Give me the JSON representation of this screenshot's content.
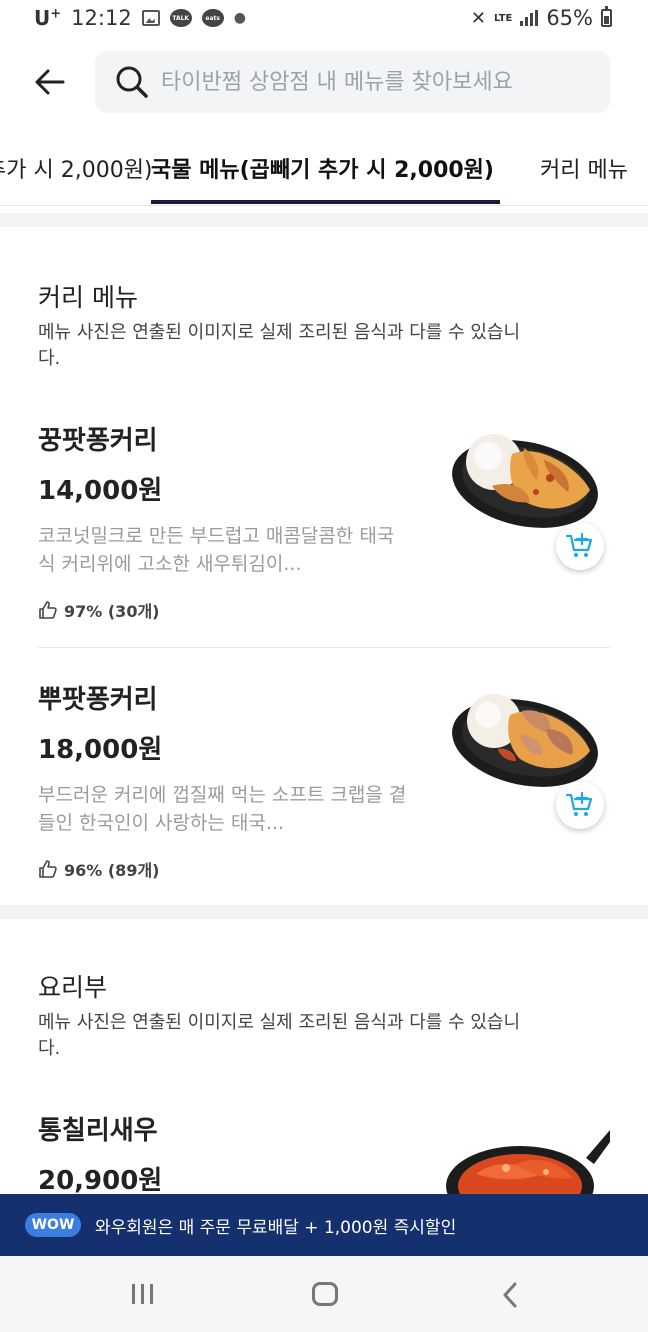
{
  "status_bar": {
    "carrier": "U",
    "carrier_sup": "+",
    "time": "12:12",
    "talk_icon_label": "TALK",
    "eats_icon_label": "eats",
    "network": "LTE",
    "battery": "65%"
  },
  "search": {
    "placeholder": "타이반쩜 상암점 내 메뉴를 찾아보세요",
    "value": ""
  },
  "tabs": [
    {
      "label": "추가 시 2,000원)",
      "active": false
    },
    {
      "label": "국물 메뉴(곱빼기 추가 시 2,000원)",
      "active": true
    },
    {
      "label": "커리 메뉴",
      "active": false
    }
  ],
  "sections": [
    {
      "title": "커리 메뉴",
      "description": "메뉴 사진은 연출된 이미지로 실제 조리된 음식과 다를 수 있습니다.",
      "items": [
        {
          "name": "꿍팟퐁커리",
          "price": "14,000원",
          "description": "코코넛밀크로 만든 부드럽고 매콤달콤한 태국식 커리위에 고소한 새우튀김이...",
          "rating": "97% (30개)"
        },
        {
          "name": "뿌팟퐁커리",
          "price": "18,000원",
          "description": "부드러운 커리에 껍질째 먹는 소프트 크랩을 곁들인 한국인이 사랑하는 태국...",
          "rating": "96% (89개)"
        }
      ]
    },
    {
      "title": "요리부",
      "description": "메뉴 사진은 연출된 이미지로 실제 조리된 음식과 다를 수 있습니다.",
      "items": [
        {
          "name": "통칠리새우",
          "price": "20,900원"
        }
      ]
    }
  ],
  "wow_banner": {
    "badge": "WOW",
    "text": "와우회원은 매 주문 무료배달 + 1,000원 즉시할인"
  },
  "colors": {
    "accent": "#1b1a3a",
    "cart_icon": "#1fa9e0",
    "banner_bg": "#14306e",
    "wow_badge": "#3c7de2"
  },
  "icons": {
    "back": "arrow-left-icon",
    "search": "search-icon",
    "cart": "add-to-cart-icon",
    "rating": "thumbs-up-icon"
  }
}
